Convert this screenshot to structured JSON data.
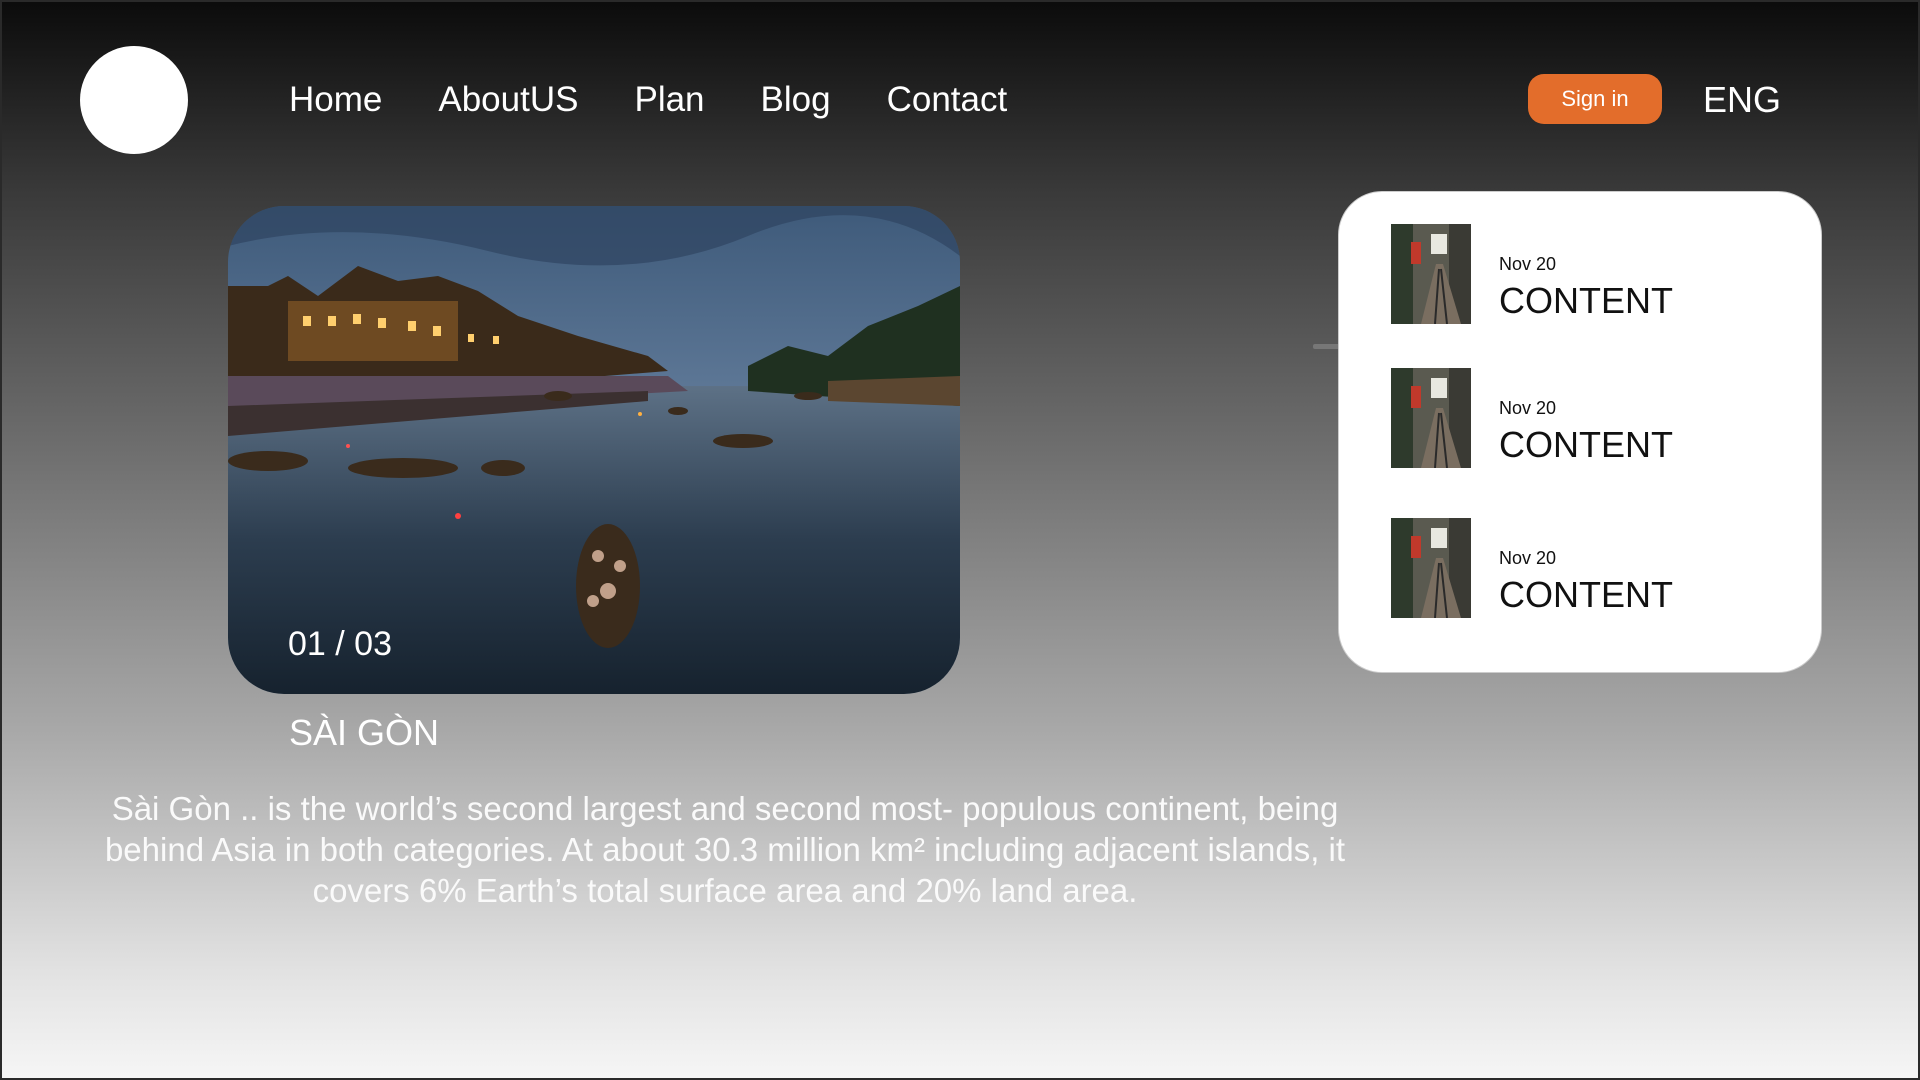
{
  "header": {
    "nav": [
      "Home",
      "AboutUS",
      "Plan",
      "Blog",
      "Contact"
    ],
    "signin_label": "Sign in",
    "language": "ENG"
  },
  "hero": {
    "counter": "01 / 03",
    "city": "SÀI GÒN",
    "description": "Sài Gòn .. is the world’s second largest and second most- populous continent, being behind Asia in both categories. At about 30.3 million km² including adjacent islands, it covers 6% Earth’s total surface area and 20% land area."
  },
  "sidebar": {
    "items": [
      {
        "date": "Nov 20",
        "title": "CONTENT"
      },
      {
        "date": "Nov 20",
        "title": "CONTENT"
      },
      {
        "date": "Nov 20",
        "title": "CONTENT"
      }
    ]
  },
  "colors": {
    "accent": "#e36d2b",
    "card_bg": "#ffffff"
  },
  "icons": {
    "logo": "circle-logo"
  }
}
